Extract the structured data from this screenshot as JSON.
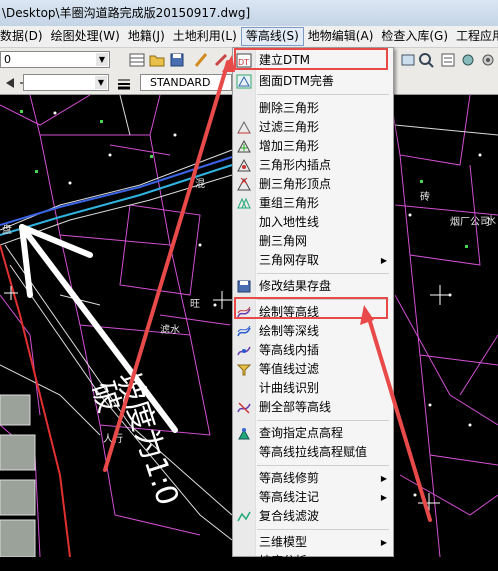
{
  "window": {
    "title": "\\Desktop\\羊圈沟道路完成版20150917.dwg]"
  },
  "menubar": {
    "items": [
      "数据(D)",
      "绘图处理(W)",
      "地籍(J)",
      "土地利用(L)",
      "等高线(S)",
      "地物编辑(A)",
      "检查入库(G)",
      "工程应用(C)"
    ]
  },
  "toolbar": {
    "layer_combo_value": "0",
    "style_combo_value": "STANDARD"
  },
  "drawing_labels": [
    "滤水",
    "旺",
    "混",
    "破",
    "坡度为1:0",
    "人行",
    "烟厂公司",
    "砖",
    "水",
    "盘"
  ],
  "menu": {
    "items": [
      {
        "label": "建立DTM",
        "icon": "build-dtm-icon",
        "highlight": true
      },
      {
        "label": "图面DTM完善",
        "icon": "dtm-refine-icon"
      },
      {
        "label": "删除三角形",
        "icon": ""
      },
      {
        "label": "过滤三角形",
        "icon": "filter-triangle-icon"
      },
      {
        "label": "增加三角形",
        "icon": "add-triangle-icon"
      },
      {
        "label": "三角形内插点",
        "icon": "triangle-interpolate-icon"
      },
      {
        "label": "删三角形顶点",
        "icon": "delete-vertex-icon"
      },
      {
        "label": "重组三角形",
        "icon": "regroup-triangle-icon"
      },
      {
        "label": "加入地性线",
        "icon": ""
      },
      {
        "label": "删三角网",
        "icon": ""
      },
      {
        "label": "三角网存取",
        "icon": "",
        "submenu": true
      },
      {
        "label": "修改结果存盘",
        "icon": "save-result-icon"
      },
      {
        "label": "绘制等高线",
        "icon": "draw-contour-icon",
        "highlight": true
      },
      {
        "label": "绘制等深线",
        "icon": "draw-isobath-icon"
      },
      {
        "label": "等高线内插",
        "icon": "contour-interpolate-icon"
      },
      {
        "label": "等值线过滤",
        "icon": "isoline-filter-icon"
      },
      {
        "label": "计曲线识别",
        "icon": ""
      },
      {
        "label": "删全部等高线",
        "icon": "delete-contours-icon"
      },
      {
        "label": "查询指定点高程",
        "icon": "query-elevation-icon"
      },
      {
        "label": "等高线拉线高程赋值",
        "icon": ""
      },
      {
        "label": "等高线修剪",
        "icon": "",
        "submenu": true
      },
      {
        "label": "等高线注记",
        "icon": "",
        "submenu": true
      },
      {
        "label": "复合线滤波",
        "icon": "polyline-filter-icon"
      },
      {
        "label": "三维模型",
        "icon": "",
        "submenu": true
      },
      {
        "label": "坡度分析",
        "icon": "",
        "submenu": true
      }
    ]
  },
  "colors": {
    "highlight_box": "#e84a4a",
    "arrow": "#e84a4a",
    "menu_bg": "#f5f5f5",
    "canvas_bg": "#000000"
  }
}
